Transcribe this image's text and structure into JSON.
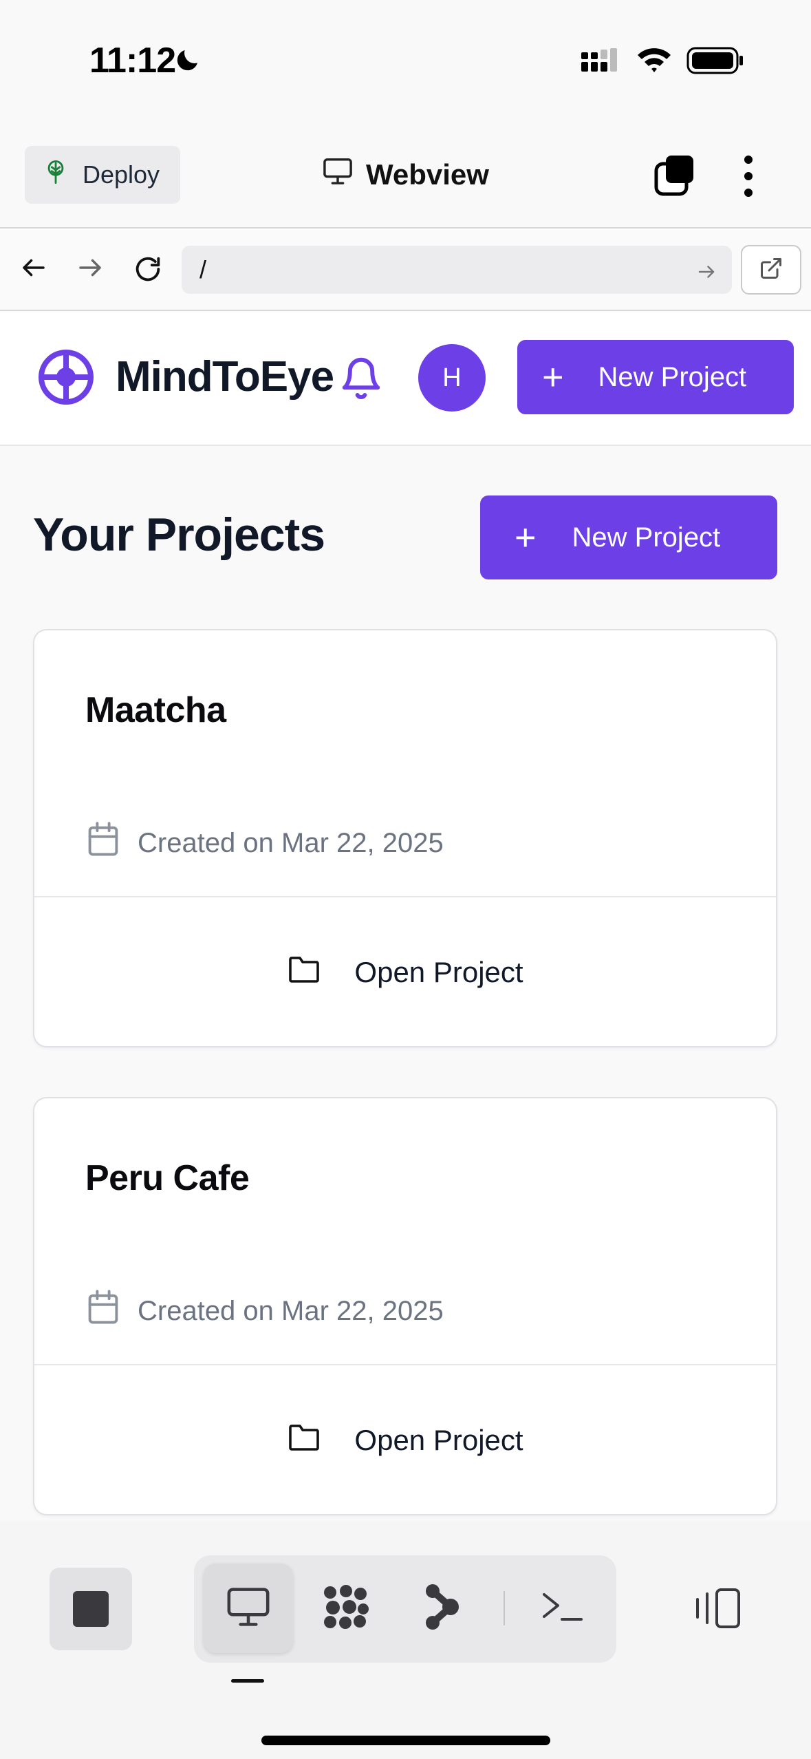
{
  "status_bar": {
    "time": "11:12"
  },
  "top_bar": {
    "deploy_label": "Deploy",
    "view_label": "Webview"
  },
  "url_bar": {
    "url": "/"
  },
  "app_header": {
    "brand": "MindToEye",
    "avatar_initial": "H",
    "new_project_label": "New Project"
  },
  "main": {
    "title": "Your Projects",
    "new_project_label": "New Project",
    "projects": [
      {
        "name": "Maatcha",
        "created": "Created on Mar 22, 2025",
        "open_label": "Open Project"
      },
      {
        "name": "Peru Cafe",
        "created": "Created on Mar 22, 2025",
        "open_label": "Open Project"
      }
    ]
  },
  "colors": {
    "accent": "#6d3fe6",
    "text_primary": "#111827",
    "text_muted": "#6b7280"
  },
  "icons": {
    "deploy": "deploy-tree-icon",
    "webview": "monitor-icon",
    "bell": "bell-icon",
    "calendar": "calendar-icon",
    "folder": "folder-icon"
  }
}
